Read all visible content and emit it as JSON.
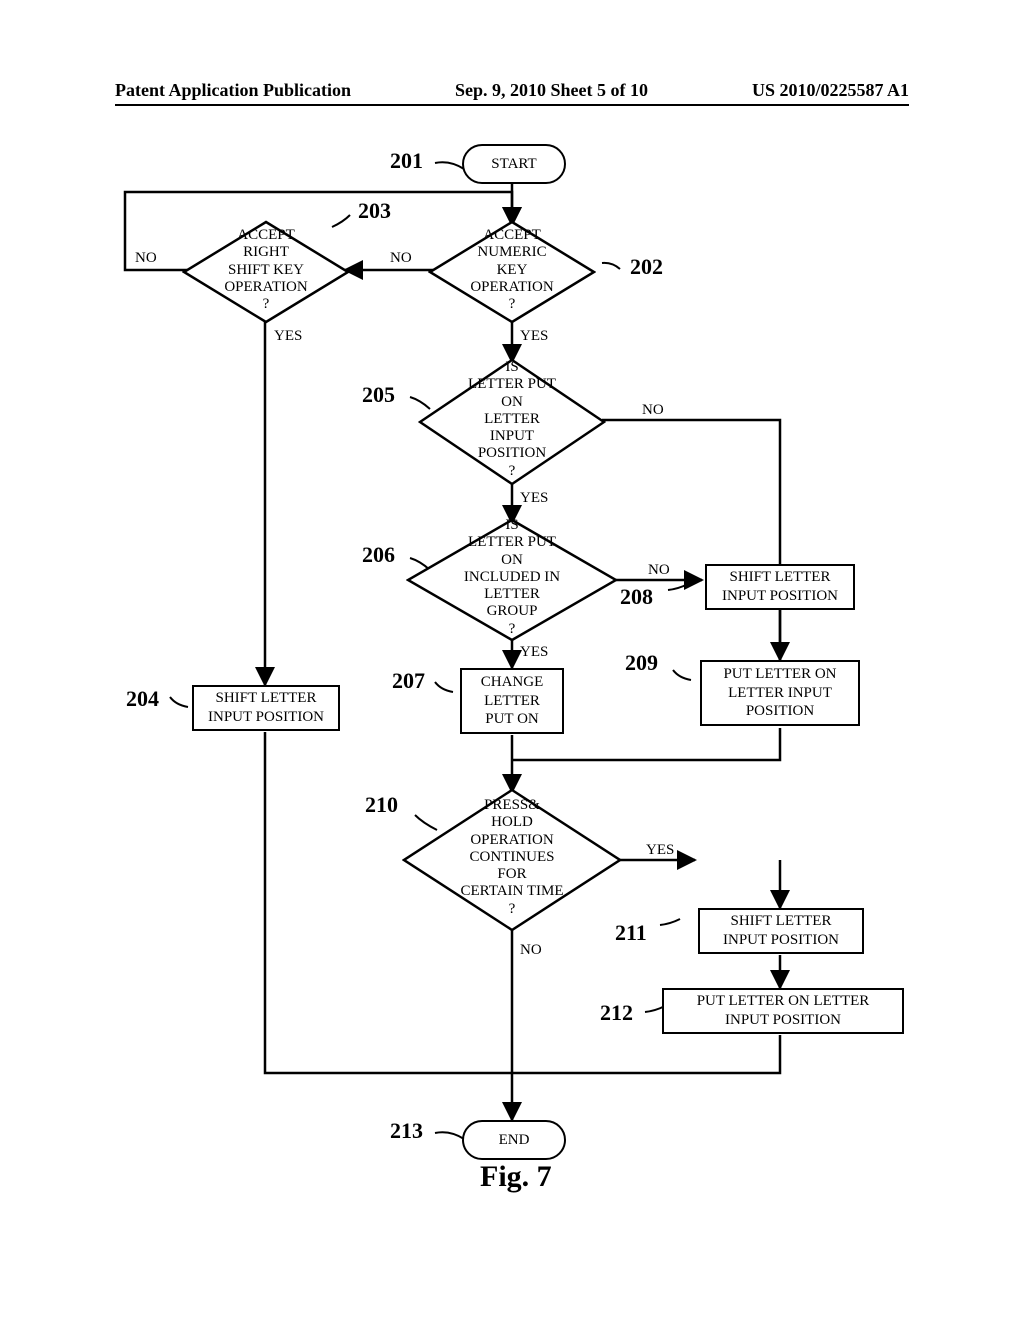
{
  "header": {
    "left": "Patent Application Publication",
    "center": "Sep. 9, 2010  Sheet 5 of 10",
    "right": "US 2010/0225587 A1"
  },
  "labels": {
    "no": "NO",
    "yes": "YES",
    "n201": "201",
    "n202": "202",
    "n203": "203",
    "n204": "204",
    "n205": "205",
    "n206": "206",
    "n207": "207",
    "n208": "208",
    "n209": "209",
    "n210": "210",
    "n211": "211",
    "n212": "212",
    "n213": "213"
  },
  "nodes": {
    "start": "START",
    "d202": "ACCEPT\nNUMERIC KEY\nOPERATION\n?",
    "d203": "ACCEPT\nRIGHT SHIFT KEY\nOPERATION\n?",
    "d205": "IS\nLETTER PUT ON\nLETTER INPUT\nPOSITION\n?",
    "d206": "IS\nLETTER PUT ON\nINCLUDED IN LETTER\nGROUP\n?",
    "b204": "SHIFT LETTER\nINPUT POSITION",
    "b207": "CHANGE\nLETTER\nPUT ON",
    "b208": "SHIFT LETTER\nINPUT POSITION",
    "b209": "PUT LETTER ON\nLETTER INPUT\nPOSITION",
    "d210": "PRESS&\nHOLD OPERATION\nCONTINUES FOR\nCERTAIN TIME\n?",
    "b211": "SHIFT LETTER\nINPUT POSITION",
    "b212": "PUT LETTER ON LETTER\nINPUT POSITION",
    "end": "END"
  },
  "caption": "Fig. 7",
  "chart_data": {
    "type": "flowchart",
    "title": "Fig. 7",
    "nodes": [
      {
        "id": "201",
        "type": "terminator",
        "text": "START"
      },
      {
        "id": "202",
        "type": "decision",
        "text": "ACCEPT NUMERIC KEY OPERATION ?"
      },
      {
        "id": "203",
        "type": "decision",
        "text": "ACCEPT RIGHT SHIFT KEY OPERATION ?"
      },
      {
        "id": "204",
        "type": "process",
        "text": "SHIFT LETTER INPUT POSITION"
      },
      {
        "id": "205",
        "type": "decision",
        "text": "IS LETTER PUT ON LETTER INPUT POSITION ?"
      },
      {
        "id": "206",
        "type": "decision",
        "text": "IS LETTER PUT ON INCLUDED IN LETTER GROUP ?"
      },
      {
        "id": "207",
        "type": "process",
        "text": "CHANGE LETTER PUT ON"
      },
      {
        "id": "208",
        "type": "process",
        "text": "SHIFT LETTER INPUT POSITION"
      },
      {
        "id": "209",
        "type": "process",
        "text": "PUT LETTER ON LETTER INPUT POSITION"
      },
      {
        "id": "210",
        "type": "decision",
        "text": "PRESS & HOLD OPERATION CONTINUES FOR CERTAIN TIME ?"
      },
      {
        "id": "211",
        "type": "process",
        "text": "SHIFT LETTER INPUT POSITION"
      },
      {
        "id": "212",
        "type": "process",
        "text": "PUT LETTER ON LETTER INPUT POSITION"
      },
      {
        "id": "213",
        "type": "terminator",
        "text": "END"
      }
    ],
    "edges": [
      {
        "from": "201",
        "to": "202"
      },
      {
        "from": "202",
        "to": "205",
        "label": "YES"
      },
      {
        "from": "202",
        "to": "203",
        "label": "NO"
      },
      {
        "from": "203",
        "to": "204",
        "label": "YES"
      },
      {
        "from": "203",
        "to": "202",
        "label": "NO",
        "note": "loop back"
      },
      {
        "from": "204",
        "to": "213",
        "note": "to END merge path"
      },
      {
        "from": "205",
        "to": "206",
        "label": "YES"
      },
      {
        "from": "205",
        "to": "209",
        "label": "NO"
      },
      {
        "from": "206",
        "to": "207",
        "label": "YES"
      },
      {
        "from": "206",
        "to": "208",
        "label": "NO"
      },
      {
        "from": "208",
        "to": "209"
      },
      {
        "from": "207",
        "to": "210"
      },
      {
        "from": "209",
        "to": "210"
      },
      {
        "from": "210",
        "to": "211",
        "label": "YES"
      },
      {
        "from": "210",
        "to": "213",
        "label": "NO"
      },
      {
        "from": "211",
        "to": "212"
      },
      {
        "from": "212",
        "to": "213"
      }
    ]
  }
}
